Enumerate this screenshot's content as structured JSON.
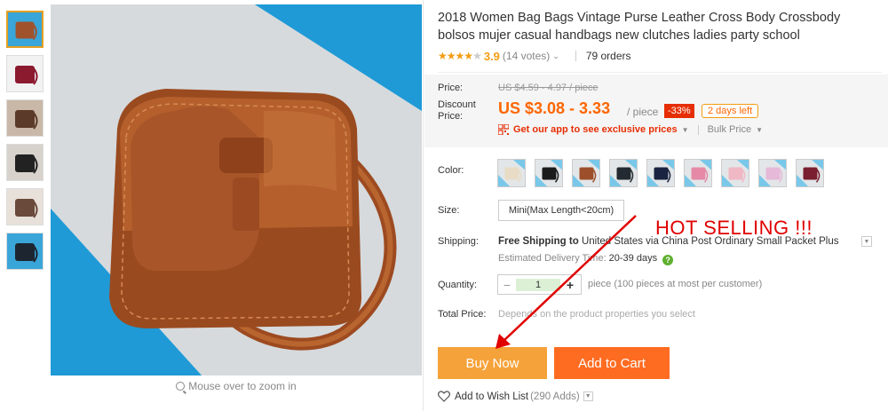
{
  "colors": {
    "accent_orange": "#f60",
    "buy_button": "#f6a23a",
    "cart_button": "#fe6c22",
    "overlay_red": "#e00000"
  },
  "thumbnails": [
    {
      "name": "thumb-brown-bag",
      "bg": "#3aa5d8",
      "bag": "#a0522d"
    },
    {
      "name": "thumb-burgundy-set",
      "bg": "#f2f2f2",
      "bag": "#8b1a2f"
    },
    {
      "name": "thumb-lifestyle-1",
      "bg": "#c9b8a8",
      "bag": "#5b3a29"
    },
    {
      "name": "thumb-lifestyle-2",
      "bg": "#d7d2cc",
      "bag": "#222222"
    },
    {
      "name": "thumb-lifestyle-3",
      "bg": "#e7e1da",
      "bag": "#6a4a3a"
    },
    {
      "name": "thumb-black-bag",
      "bg": "#3aa5d8",
      "bag": "#1c2530"
    }
  ],
  "zoom_hint": "Mouse over to zoom in",
  "product": {
    "title": "2018 Women Bag Bags Vintage Purse Leather Cross Body Crossbody bolsos mujer casual handbags new clutches ladies party school",
    "rating": "3.9",
    "rating_stars": 4,
    "votes": "(14 votes)",
    "orders": "79 orders"
  },
  "price": {
    "price_label": "Price:",
    "original": "US $4.59 - 4.97 / piece",
    "discount_label_1": "Discount",
    "discount_label_2": "Price:",
    "discounted": "US $3.08 - 3.33",
    "per_piece": "/ piece",
    "off_badge": "-33%",
    "days_left": "2 days left",
    "app_link": "Get our app to see exclusive prices",
    "bulk_price": "Bulk Price"
  },
  "color": {
    "label": "Color:",
    "swatches": [
      {
        "name": "swatch-beige",
        "bag": "#e9dcc6",
        "bg": "#79c8ea"
      },
      {
        "name": "swatch-black",
        "bag": "#1b1b1b",
        "bg": "#79c8ea"
      },
      {
        "name": "swatch-brown",
        "bag": "#9c4f2a",
        "bg": "#79c8ea"
      },
      {
        "name": "swatch-dark",
        "bag": "#242a31",
        "bg": "#79c8ea"
      },
      {
        "name": "swatch-navy",
        "bag": "#1a2340",
        "bg": "#79c8ea"
      },
      {
        "name": "swatch-pink",
        "bag": "#e58aa6",
        "bg": "#79c8ea"
      },
      {
        "name": "swatch-light-pink",
        "bag": "#f0b7c4",
        "bg": "#79c8ea"
      },
      {
        "name": "swatch-lavender",
        "bag": "#e6b9d8",
        "bg": "#79c8ea"
      },
      {
        "name": "swatch-wine",
        "bag": "#7a1f2f",
        "bg": "#79c8ea"
      }
    ]
  },
  "size": {
    "label": "Size:",
    "selected": "Mini(Max Length<20cm)"
  },
  "shipping": {
    "label": "Shipping:",
    "free": "Free Shipping to",
    "destination": "United States via China Post Ordinary Small Packet Plus",
    "estimated_label": "Estimated Delivery Time:",
    "estimated_days": "20-39 days",
    "help_icon": "?"
  },
  "quantity": {
    "label": "Quantity:",
    "minus": "−",
    "value": "1",
    "plus": "+",
    "note": "piece (100 pieces at most per customer)"
  },
  "total": {
    "label": "Total Price:",
    "note": "Depends on the product properties you select"
  },
  "buttons": {
    "buy_now": "Buy Now",
    "add_to_cart": "Add to Cart"
  },
  "wishlist": {
    "label": "Add to Wish List",
    "count": "(290 Adds)"
  },
  "overlay": {
    "hot_selling": "HOT SELLING !!!"
  }
}
